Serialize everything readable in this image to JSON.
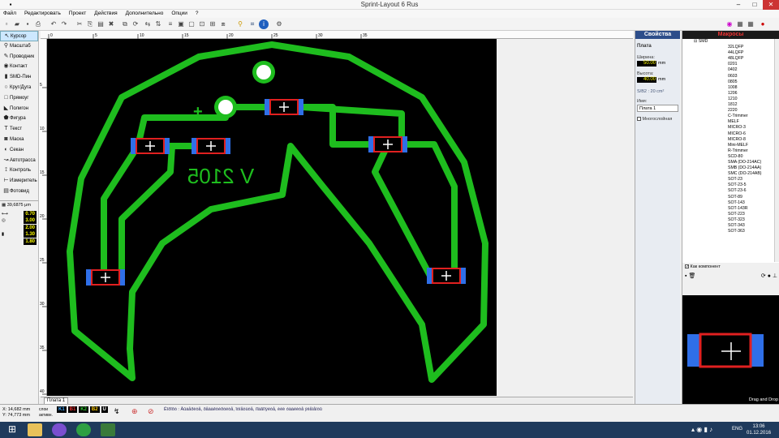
{
  "window": {
    "title": "Sprint-Layout 6 Rus"
  },
  "menu": [
    "Файл",
    "Редактировать",
    "Проект",
    "Действия",
    "Дополнительно",
    "Опции",
    "?"
  ],
  "tools": [
    {
      "label": "Курсор",
      "icon": "cursor-icon",
      "selected": true
    },
    {
      "label": "Масштаб",
      "icon": "zoom-icon"
    },
    {
      "label": "Проводник",
      "icon": "pen-icon"
    },
    {
      "label": "Контакт",
      "icon": "pad-icon"
    },
    {
      "label": "SMD-Пин",
      "icon": "smd-icon"
    },
    {
      "label": "Круг/Дуга",
      "icon": "circle-icon"
    },
    {
      "label": "Прямоуг",
      "icon": "rect-icon"
    },
    {
      "label": "Полигон",
      "icon": "polygon-icon"
    },
    {
      "label": "Фигура",
      "icon": "shape-icon"
    },
    {
      "label": "Текст",
      "icon": "text-icon"
    },
    {
      "label": "Маска",
      "icon": "mask-icon"
    },
    {
      "label": "Секан",
      "icon": "cutout-icon"
    },
    {
      "label": "Автотрасса",
      "icon": "autoroute-icon"
    },
    {
      "label": "Контроль",
      "icon": "test-icon"
    },
    {
      "label": "Измеритель",
      "icon": "measure-icon"
    },
    {
      "label": "Фотовид",
      "icon": "photo-icon"
    }
  ],
  "grid": {
    "value": "39,6875 μm"
  },
  "widths": {
    "track": "0.70",
    "pad_outer": "3.00",
    "pad_inner": "2.00",
    "smd_w": "1.30",
    "smd_h": "1.80"
  },
  "ruler": {
    "top": [
      "0",
      "5",
      "10",
      "15",
      "20",
      "25",
      "30",
      "35"
    ],
    "left": [
      "5",
      "10",
      "15",
      "20",
      "25",
      "30",
      "35",
      "40"
    ]
  },
  "board": {
    "tab": "Плата 1",
    "text_label": "V 2105"
  },
  "properties": {
    "header": "Свойства",
    "section": "Плата",
    "width_label": "Ширина:",
    "width_value": "50.00",
    "width_unit": "mm",
    "height_label": "Высота:",
    "height_value": "40.00",
    "height_unit": "mm",
    "area": "S/B2 :   20 cm²",
    "name_label": "Имя:",
    "name_value": "Плата 1",
    "multilayer": "Многослойная"
  },
  "macros": {
    "header": "Макросы",
    "root": "SMD",
    "items": [
      "32LQFP",
      "44LQFP",
      "48LQFP",
      "0201",
      "0402",
      "0603",
      "0805",
      "1008",
      "1206",
      "1210",
      "1812",
      "2220",
      "C-Trimmer",
      "MELF",
      "MICRO-3",
      "MICRO-6",
      "MICRO-8",
      "Mini-MELF",
      "R-Trimmer",
      "SCD-80",
      "SMA (DO-214AC)",
      "SMB (DO-214AA)",
      "SMC (DO-214AB)",
      "SOT-23",
      "SOT-23-5",
      "SOT-23-6",
      "SOT-89",
      "SOT-143",
      "SOT-143R",
      "SOT-223",
      "SOT-323",
      "SOT-343",
      "SOT-363"
    ],
    "as_component": "Как компонент",
    "drag_drop": "Drag and Drop"
  },
  "status": {
    "x_label": "X:",
    "x_value": "14,682 mm",
    "y_label": "Y:",
    "y_value": "74,773 mm",
    "layers_label": "слои",
    "active_label": "активн.",
    "layers": [
      "K1",
      "B1",
      "K2",
      "B2",
      "U"
    ],
    "message": "Êîðîõò  : Âûáåðèòå, ðåäàêòèðóéòå, îòìåòüòå, ïîäãîíÿéòå, èëè óäàëèòå ýëåìåíòû"
  },
  "taskbar": {
    "lang": "ENG",
    "time": "13:06",
    "date": "01.12.2016"
  },
  "colors": {
    "track": "#1ebd1e",
    "canvas": "#000000",
    "pad_blue": "#2f6fe8",
    "pad_red": "#e02020",
    "hdr_blue": "#2c4d8a"
  }
}
